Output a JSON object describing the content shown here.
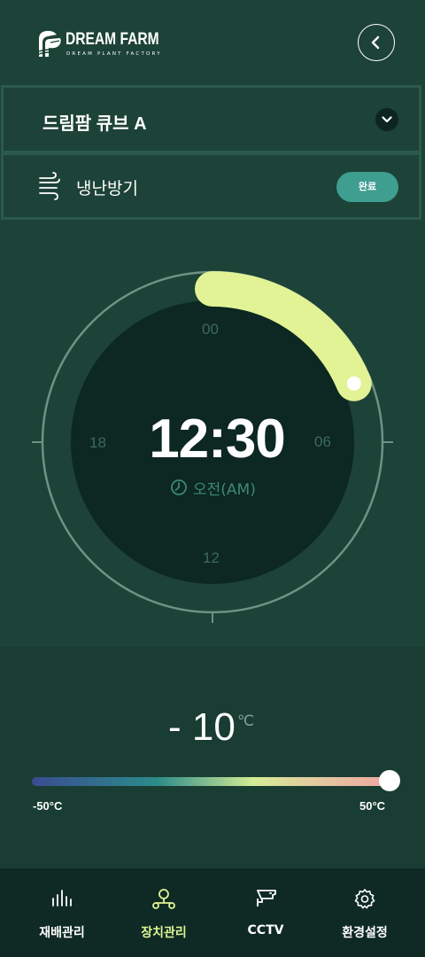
{
  "header": {
    "logo_title": "DREAM FARM",
    "logo_subtitle": "DREAM PLANT FACTORY",
    "back_icon": "chevron-left-icon"
  },
  "farm_selector": {
    "selected": "드림팜 큐브 A",
    "icon": "chevron-down-icon"
  },
  "device": {
    "name": "냉난방기",
    "icon": "wind-icon",
    "action_label": "완료"
  },
  "clock": {
    "hour_labels": {
      "top": "00",
      "right": "06",
      "bottom": "12",
      "left": "18"
    },
    "time": "12:30",
    "period": "오전(AM)",
    "arc_start_hour": 0,
    "arc_end_hour": 4.5,
    "colors": {
      "arc": "#e1f394",
      "dial": "#0d2722",
      "ring": "#6f9285"
    }
  },
  "temperature": {
    "sign": "-",
    "value": "10",
    "display": "- 10",
    "unit": "℃",
    "min_label": "-50°C",
    "max_label": "50°C",
    "min": -50,
    "max": 50,
    "slider_value": 50
  },
  "bottom_nav": {
    "items": [
      {
        "label": "재배관리",
        "icon": "bar-chart-icon",
        "active": false
      },
      {
        "label": "장치관리",
        "icon": "network-icon",
        "active": true
      },
      {
        "label": "CCTV",
        "icon": "cctv-camera-icon",
        "active": false
      },
      {
        "label": "환경설정",
        "icon": "gear-icon",
        "active": false
      }
    ],
    "active_color": "#dff394"
  }
}
